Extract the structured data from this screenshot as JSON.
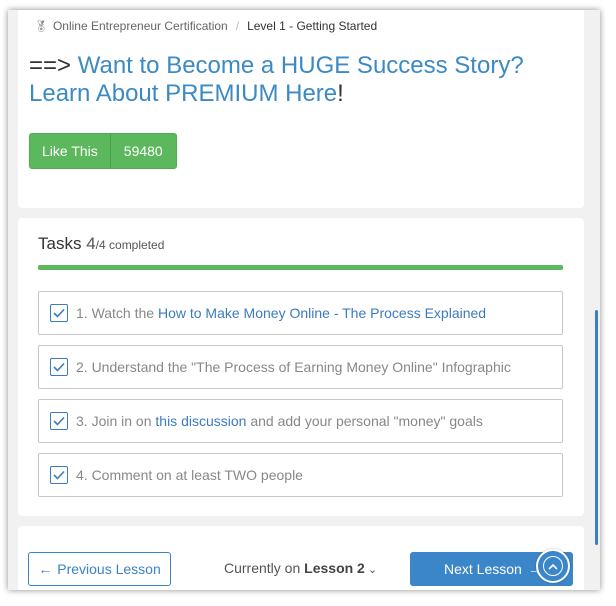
{
  "breadcrumb": {
    "parent": "Online Entrepreneur Certification",
    "separator": "/",
    "current": "Level 1 - Getting Started"
  },
  "promo": {
    "prefix": "==> ",
    "link_line1": "Want to Become a HUGE Success Story?",
    "link_line2": "Learn About PREMIUM Here",
    "suffix": "!"
  },
  "like": {
    "label": "Like This",
    "count": "59480"
  },
  "tasks": {
    "title": "Tasks",
    "done": "4",
    "total": "/4 completed",
    "progress_fraction": 1.0,
    "items": [
      {
        "before": "1. Watch the ",
        "link": "How to Make Money Online - The Process Explained",
        "after": ""
      },
      {
        "before": "2. Understand the \"The Process of Earning Money Online\" Infographic",
        "link": "",
        "after": ""
      },
      {
        "before": "3. Join in on ",
        "link": "this discussion",
        "after": " and add your personal \"money\" goals"
      },
      {
        "before": "4. Comment on at least TWO people",
        "link": "",
        "after": ""
      }
    ]
  },
  "nav": {
    "prev_arrow": "←",
    "prev_label": "Previous Lesson",
    "current_prefix": "Currently on ",
    "current_lesson": "Lesson 2",
    "next_label": "Next Lesson",
    "next_arrow": "→"
  },
  "colors": {
    "accent": "#3b86c9",
    "success": "#5cb85c"
  }
}
